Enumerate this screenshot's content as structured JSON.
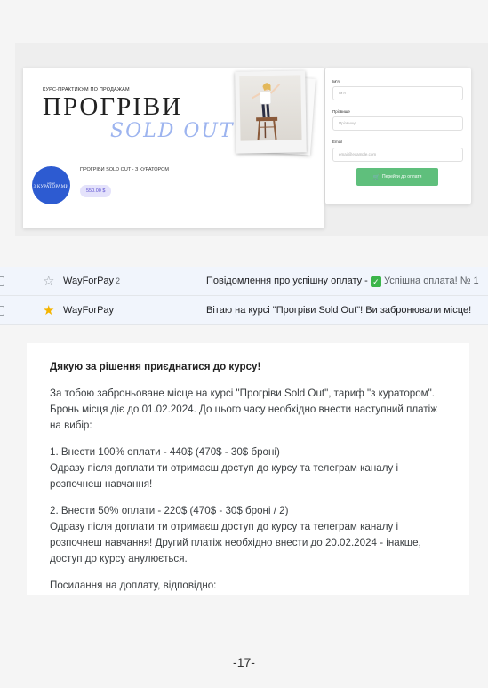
{
  "landing": {
    "eyebrow": "КУРС-ПРАКТИКУМ ПО ПРОДАЖАМ",
    "title": "ПРОГРІВИ",
    "subtitle": "SOLD OUT",
    "logo_top": "school",
    "logo_main": "3 КУРАТОРАМИ",
    "product": "ПРОГРІВИ SOLD OUT - З КУРАТОРОМ",
    "price": "550.00 $"
  },
  "form": {
    "name_label": "Ім'я",
    "name_placeholder": "Ім'я",
    "surname_label": "Прізвище",
    "surname_placeholder": "Прізвище",
    "email_label": "Email",
    "email_placeholder": "email@example.com",
    "pay_button": "Перейти до оплати"
  },
  "mail_list": [
    {
      "sender": "WayForPay",
      "count": "2",
      "starred": false,
      "subject": "Повідомлення про успішну оплату - ",
      "snippet": " Успішна оплата! № 1"
    },
    {
      "sender": "WayForPay",
      "count": "",
      "starred": true,
      "subject": "Вітаю на курсі \"Прогріви Sold Out\"! Ви забронювали місце!",
      "snippet": ""
    }
  ],
  "mail_body": {
    "lead": "Дякую за рішення приєднатися до курсу!",
    "p1": "За тобою заброньоване місце на курсі \"Прогріви Sold Out\", тариф \"з куратором\". Бронь місця діє до 01.02.2024. До цього часу необхідно внести наступний платіж на вибір:",
    "p2_title": "1. Внести 100% оплати - 440$ (470$ - 30$ броні)",
    "p2_text": "Одразу після доплати ти отримаєш доступ до курсу та телеграм каналу і розпочнеш навчання!",
    "p3_title": "2. Внести 50% оплати - 220$ (470$ - 30$ броні / 2)",
    "p3_text": "Одразу після доплати ти отримаєш доступ до курсу та телеграм каналу і розпочнеш навчання! Другий платіж необхідно внести до 20.02.2024 - інакше, доступ до курсу анулюється.",
    "p4": "Посилання на доплату, відповідно:"
  },
  "page_number": "-17-",
  "colors": {
    "accent_blue": "#2d5bd1",
    "pay_green": "#5fbf7c",
    "star_yellow": "#f4b400",
    "check_green": "#3bb54a"
  }
}
